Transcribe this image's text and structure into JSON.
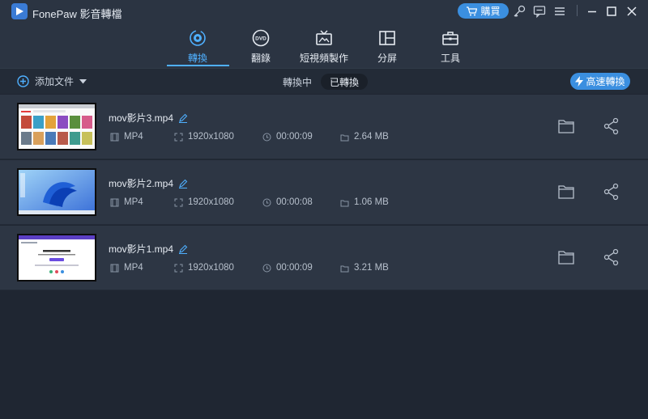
{
  "app": {
    "title": "FonePaw 影音轉檔",
    "buy_label": "購買"
  },
  "nav": {
    "tabs": [
      {
        "label": "轉換",
        "icon": "convert-icon",
        "active": true
      },
      {
        "label": "翻錄",
        "icon": "dvd-icon",
        "active": false
      },
      {
        "label": "短視頻製作",
        "icon": "tv-icon",
        "active": false
      },
      {
        "label": "分屏",
        "icon": "split-screen-icon",
        "active": false
      },
      {
        "label": "工具",
        "icon": "toolbox-icon",
        "active": false
      }
    ]
  },
  "toolbar": {
    "add_file_label": "添加文件",
    "segments": [
      {
        "label": "轉換中",
        "active": false
      },
      {
        "label": "已轉換",
        "active": true
      }
    ],
    "fast_convert_label": "高速轉換"
  },
  "files": [
    {
      "name": "mov影片3.mp4",
      "format": "MP4",
      "resolution": "1920x1080",
      "duration": "00:00:09",
      "size": "2.64 MB"
    },
    {
      "name": "mov影片2.mp4",
      "format": "MP4",
      "resolution": "1920x1080",
      "duration": "00:00:08",
      "size": "1.06 MB"
    },
    {
      "name": "mov影片1.mp4",
      "format": "MP4",
      "resolution": "1920x1080",
      "duration": "00:00:09",
      "size": "3.21 MB"
    }
  ],
  "colors": {
    "accent": "#4fb0ff",
    "button": "#3b8fe0",
    "background": "#1f2632",
    "row": "#2d3644"
  }
}
